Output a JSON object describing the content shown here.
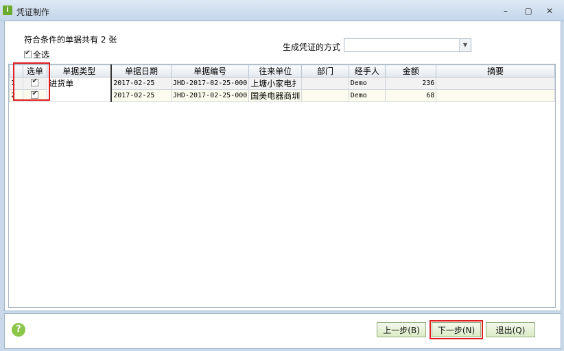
{
  "window": {
    "icon_name": "app-icon",
    "title": "凭证制作",
    "controls": {
      "minimize": "–",
      "maximize": "▢",
      "close": "✕"
    }
  },
  "summary": {
    "count_text": "符合条件的单据共有 2 张"
  },
  "select_all": {
    "label": "全选",
    "checked": true
  },
  "voucher_method": {
    "label": "生成凭证的方式",
    "value": ""
  },
  "table": {
    "columns": [
      "选单",
      "单据类型",
      "单据日期",
      "单据编号",
      "往来单位",
      "部门",
      "经手人",
      "金额",
      "摘要"
    ],
    "doc_type": "进货单",
    "rows": [
      {
        "index": "1",
        "selected": true,
        "date": "2017-02-25",
        "number": "JHD-2017-02-25-000",
        "partner": "上塘小家电扌",
        "department": "",
        "handler": "Demo",
        "amount": "236",
        "memo": ""
      },
      {
        "index": "2",
        "selected": true,
        "date": "2017-02-25",
        "number": "JHD-2017-02-25-000",
        "partner": "国美电器商圳",
        "department": "",
        "handler": "Demo",
        "amount": "68",
        "memo": ""
      }
    ]
  },
  "buttons": {
    "prev": "上一步(B)",
    "next": "下一步(N)",
    "exit": "退出(Q)"
  },
  "highlight_color": "#e02020"
}
